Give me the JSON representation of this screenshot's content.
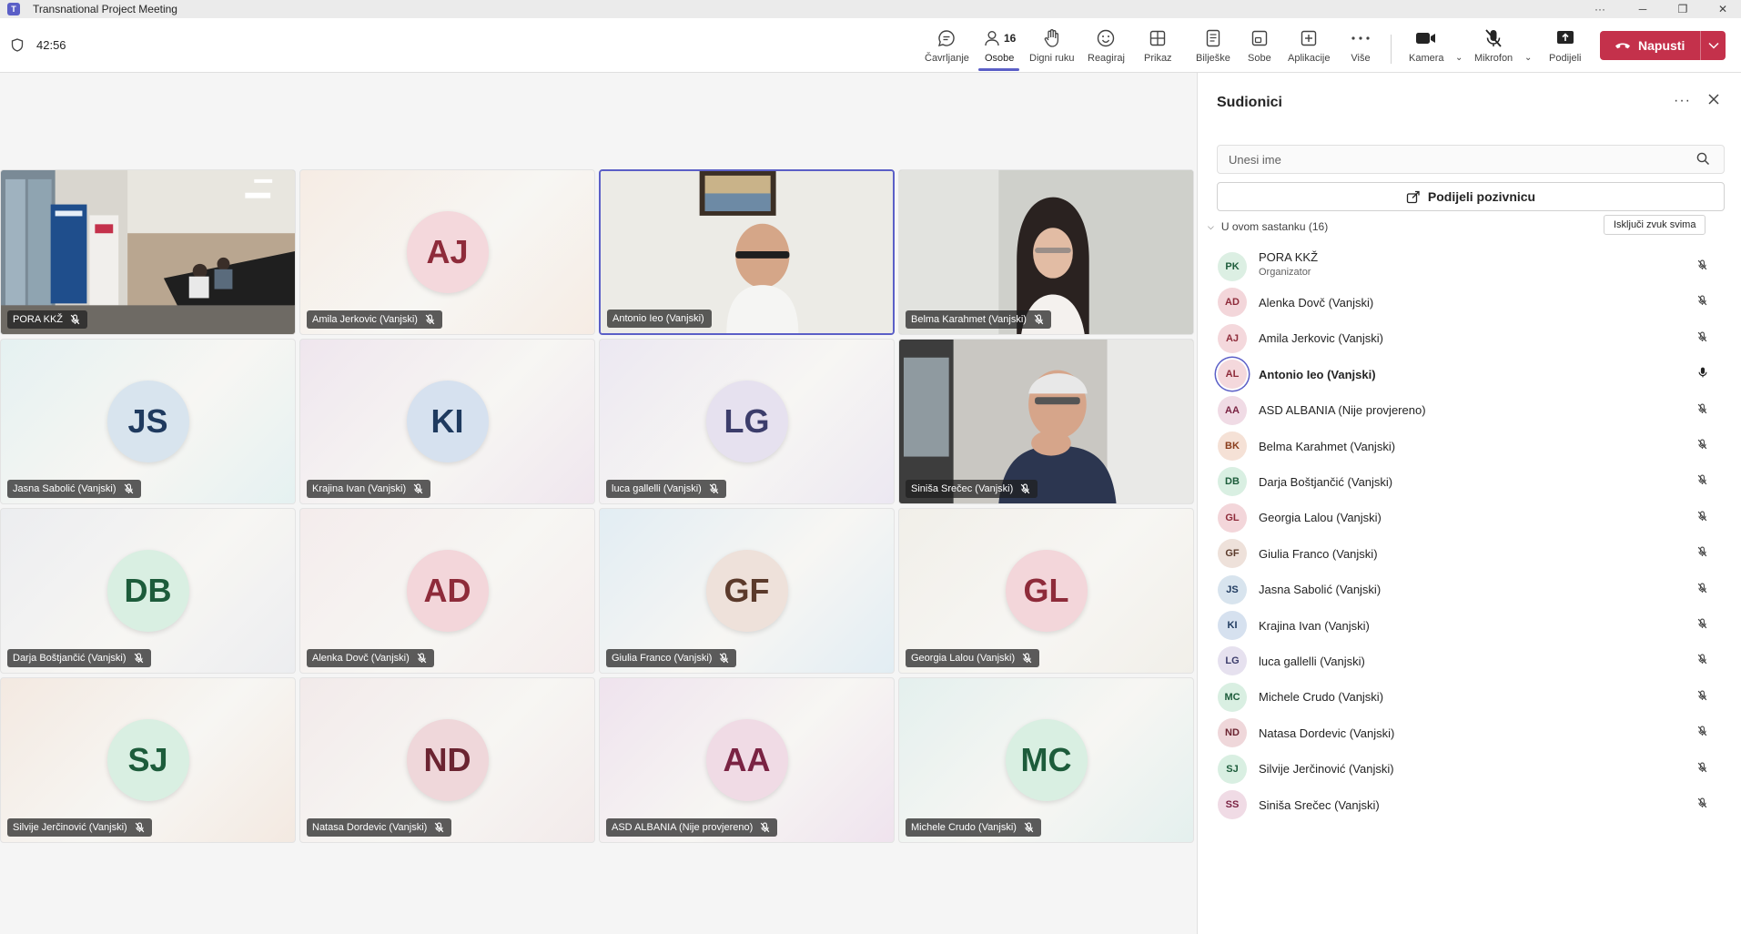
{
  "window": {
    "title": "Transnational Project Meeting",
    "controls": {
      "more": "···",
      "minimize": "─",
      "restore": "❐",
      "close": "✕"
    }
  },
  "toolbar": {
    "timer": "42:56",
    "chat": "Čavrljanje",
    "people": "Osobe",
    "people_count": "16",
    "raise": "Digni ruku",
    "react": "Reagiraj",
    "view": "Prikaz",
    "notes": "Bilješke",
    "rooms": "Sobe",
    "apps": "Aplikacije",
    "more": "Više",
    "camera": "Kamera",
    "mic": "Mikrofon",
    "share": "Podijeli",
    "leave": "Napusti"
  },
  "grid": {
    "tiles": [
      {
        "name": "PORA KKŽ",
        "type": "video",
        "scene": "conference"
      },
      {
        "name": "Amila Jerkovic (Vanjski)",
        "initials": "AJ",
        "bg": "#f6ece4",
        "avbg": "#f4d8dc",
        "fg": "#8e2b3a"
      },
      {
        "name": "Antonio Ieo (Vanjski)",
        "type": "video",
        "scene": "man-glasses",
        "speaking": true
      },
      {
        "name": "Belma Karahmet (Vanjski)",
        "type": "video",
        "scene": "woman"
      },
      {
        "name": "Jasna Sabolić (Vanjski)",
        "initials": "JS",
        "bg": "#e5f1f1",
        "avbg": "#d8e4ee",
        "fg": "#1f3a5f"
      },
      {
        "name": "Krajina Ivan (Vanjski)",
        "initials": "KI",
        "bg": "#efe6ee",
        "avbg": "#d6e1ef",
        "fg": "#1f3a5f"
      },
      {
        "name": "luca gallelli (Vanjski)",
        "initials": "LG",
        "bg": "#ece8f2",
        "avbg": "#e6e1ef",
        "fg": "#3c3d6b"
      },
      {
        "name": "Siniša Srečec (Vanjski)",
        "type": "video",
        "scene": "older-man"
      },
      {
        "name": "Darja Boštjančić (Vanjski)",
        "initials": "DB",
        "bg": "#ecedf0",
        "avbg": "#d9efe2",
        "fg": "#1d5c3b"
      },
      {
        "name": "Alenka Dovč (Vanjski)",
        "initials": "AD",
        "bg": "#f4ecec",
        "avbg": "#f3d6da",
        "fg": "#8e2b3a"
      },
      {
        "name": "Giulia Franco (Vanjski)",
        "initials": "GF",
        "bg": "#e2edf3",
        "avbg": "#eee1da",
        "fg": "#5b3a2b"
      },
      {
        "name": "Georgia Lalou (Vanjski)",
        "initials": "GL",
        "bg": "#f1efe9",
        "avbg": "#f3d6da",
        "fg": "#8e2b3a"
      },
      {
        "name": "Silvije Jerčinović (Vanjski)",
        "initials": "SJ",
        "bg": "#f3e9e1",
        "avbg": "#d9efe2",
        "fg": "#1d5c3b"
      },
      {
        "name": "Natasa Dordevic (Vanjski)",
        "initials": "ND",
        "bg": "#f2eaea",
        "avbg": "#efd7da",
        "fg": "#6b2431"
      },
      {
        "name": "ASD ALBANIA (Nije provjereno)",
        "initials": "AA",
        "bg": "#efe3ee",
        "avbg": "#f0dbe5",
        "fg": "#7a2343"
      },
      {
        "name": "Michele Crudo (Vanjski)",
        "initials": "MC",
        "bg": "#e4f0ee",
        "avbg": "#d9efe2",
        "fg": "#1d5c3b"
      }
    ]
  },
  "panel": {
    "title": "Sudionici",
    "search_placeholder": "Unesi ime",
    "share_invite": "Podijeli pozivnicu",
    "section": "U ovom sastanku (16)",
    "mute_all": "Isključi zvuk svima",
    "participants": [
      {
        "initials": "PK",
        "name": "PORA KKŽ",
        "role": "Organizator",
        "avbg": "#dcefe3",
        "fg": "#1d5c3b"
      },
      {
        "initials": "AD",
        "name": "Alenka Dovč (Vanjski)",
        "avbg": "#f3d6da",
        "fg": "#8e2b3a"
      },
      {
        "initials": "AJ",
        "name": "Amila Jerkovic (Vanjski)",
        "avbg": "#f4d8dc",
        "fg": "#8e2b3a"
      },
      {
        "initials": "AL",
        "name": "Antonio Ieo (Vanjski)",
        "avbg": "#f4d8dc",
        "fg": "#8e2b3a",
        "speaking": true
      },
      {
        "initials": "AA",
        "name": "ASD ALBANIA (Nije provjereno)",
        "avbg": "#f0dbe5",
        "fg": "#7a2343"
      },
      {
        "initials": "BK",
        "name": "Belma Karahmet (Vanjski)",
        "avbg": "#f5e1d6",
        "fg": "#8a3d1c"
      },
      {
        "initials": "DB",
        "name": "Darja Boštjančić (Vanjski)",
        "avbg": "#d9efe2",
        "fg": "#1d5c3b"
      },
      {
        "initials": "GL",
        "name": "Georgia Lalou (Vanjski)",
        "avbg": "#f3d6da",
        "fg": "#8e2b3a"
      },
      {
        "initials": "GF",
        "name": "Giulia Franco (Vanjski)",
        "avbg": "#eee1da",
        "fg": "#5b3a2b"
      },
      {
        "initials": "JS",
        "name": "Jasna Sabolić (Vanjski)",
        "avbg": "#d8e4ee",
        "fg": "#1f3a5f"
      },
      {
        "initials": "KI",
        "name": "Krajina Ivan (Vanjski)",
        "avbg": "#d6e1ef",
        "fg": "#1f3a5f"
      },
      {
        "initials": "LG",
        "name": "luca gallelli (Vanjski)",
        "avbg": "#e6e1ef",
        "fg": "#3c3d6b"
      },
      {
        "initials": "MC",
        "name": "Michele Crudo (Vanjski)",
        "avbg": "#d9efe2",
        "fg": "#1d5c3b"
      },
      {
        "initials": "ND",
        "name": "Natasa Dordevic (Vanjski)",
        "avbg": "#efd7da",
        "fg": "#6b2431"
      },
      {
        "initials": "SJ",
        "name": "Silvije Jerčinović (Vanjski)",
        "avbg": "#d9efe2",
        "fg": "#1d5c3b"
      },
      {
        "initials": "SS",
        "name": "Siniša Srečec (Vanjski)",
        "avbg": "#f0dbe5",
        "fg": "#7a2343"
      }
    ]
  },
  "colors": {
    "accent": "#5b5fc7",
    "leave": "#c4314b"
  }
}
